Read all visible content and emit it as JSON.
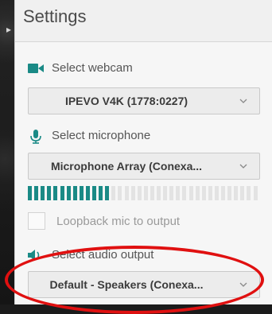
{
  "header": {
    "title": "Settings"
  },
  "webcam": {
    "icon": "video-camera-icon",
    "label": "Select webcam",
    "selected": "IPEVO V4K (1778:0227)"
  },
  "microphone": {
    "icon": "microphone-icon",
    "label": "Select microphone",
    "selected": "Microphone Array (Conexa...",
    "level_active_segments": 13,
    "level_total_segments": 36
  },
  "loopback": {
    "label": "Loopback mic to output",
    "checked": false
  },
  "audio_output": {
    "icon": "speaker-icon",
    "label": "Select audio output",
    "selected": "Default - Speakers (Conexa..."
  },
  "colors": {
    "accent": "#1a8a86",
    "annotation": "#e01010"
  }
}
